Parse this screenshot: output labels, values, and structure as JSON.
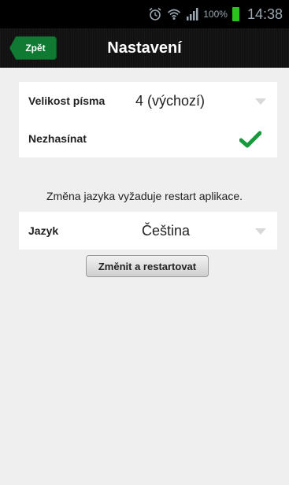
{
  "status_bar": {
    "icons": [
      "alarm-clock-icon",
      "wifi-icon",
      "signal-icon",
      "battery-icon"
    ],
    "battery": "100%",
    "time": "14:38",
    "battery_color": "#28c31b"
  },
  "header": {
    "back_label": "Zpět",
    "title": "Nastavení",
    "back_color": "#107a33"
  },
  "settings": {
    "font_size_label": "Velikost písma",
    "font_size_value": "4 (výchozí)",
    "keep_awake_label": "Nezhasínat",
    "keep_awake_checked": true,
    "check_color": "#169a3b"
  },
  "language": {
    "info": "Změna jazyka vyžaduje restart aplikace.",
    "label": "Jazyk",
    "value": "Čeština",
    "button_label": "Změnit a restartovat"
  }
}
